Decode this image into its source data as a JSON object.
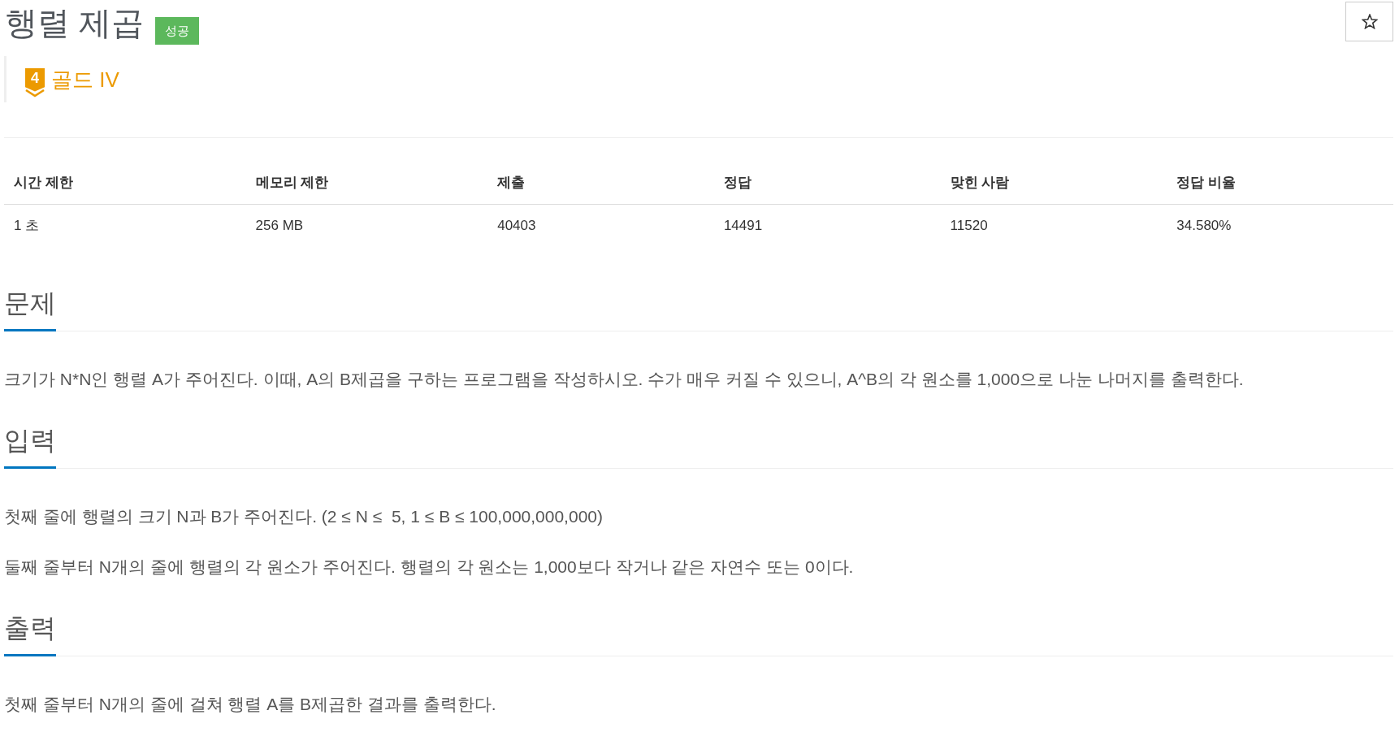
{
  "problem": {
    "title": "행렬 제곱",
    "status_badge": "성공",
    "tier": {
      "number": "4",
      "label": "골드 IV"
    }
  },
  "stats_table": {
    "columns": [
      "시간 제한",
      "메모리 제한",
      "제출",
      "정답",
      "맞힌 사람",
      "정답 비율"
    ],
    "rows": [
      [
        "1 초",
        "256 MB",
        "40403",
        "14491",
        "11520",
        "34.580%"
      ]
    ]
  },
  "sections": [
    {
      "heading": "문제",
      "paragraphs": [
        "크기가 N*N인 행렬 A가 주어진다. 이때, A의 B제곱을 구하는 프로그램을 작성하시오. 수가 매우 커질 수 있으니, A^B의 각 원소를 1,000으로 나눈 나머지를 출력한다."
      ]
    },
    {
      "heading": "입력",
      "paragraphs": [
        "첫째 줄에 행렬의 크기 N과 B가 주어진다. (2 ≤ N ≤  5, 1 ≤ B ≤ 100,000,000,000)",
        "둘째 줄부터 N개의 줄에 행렬의 각 원소가 주어진다. 행렬의 각 원소는 1,000보다 작거나 같은 자연수 또는 0이다."
      ]
    },
    {
      "heading": "출력",
      "paragraphs": [
        "첫째 줄부터 N개의 줄에 걸쳐 행렬 A를 B제곱한 결과를 출력한다."
      ]
    }
  ]
}
